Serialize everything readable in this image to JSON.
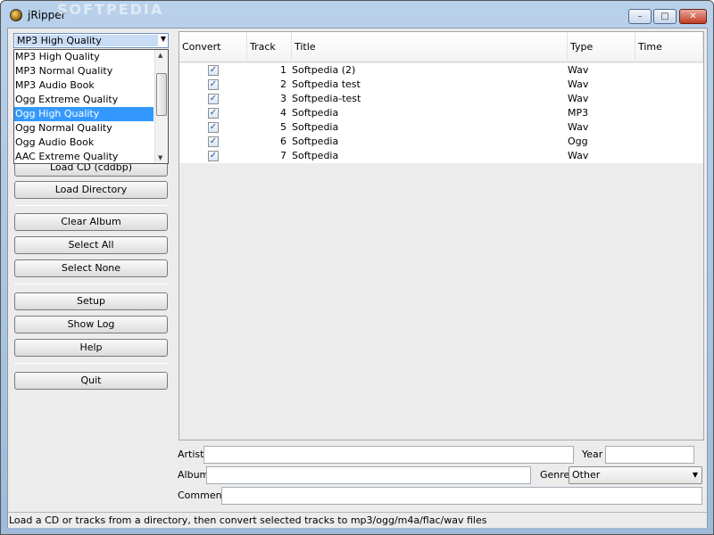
{
  "window": {
    "title": "jRipper",
    "watermark": "SOFTPEDIA"
  },
  "quality": {
    "selected": "MP3 High Quality",
    "options": [
      "MP3 High Quality",
      "MP3 Normal Quality",
      "MP3 Audio Book",
      "Ogg Extreme Quality",
      "Ogg High Quality",
      "Ogg Normal Quality",
      "Ogg Audio Book",
      "AAC Extreme Quality"
    ],
    "highlighted": "Ogg High Quality"
  },
  "buttons": {
    "load_cd": "Load CD (cddbp)",
    "load_directory": "Load Directory",
    "clear_album": "Clear Album",
    "select_all": "Select All",
    "select_none": "Select None",
    "setup": "Setup",
    "show_log": "Show Log",
    "help": "Help",
    "quit": "Quit"
  },
  "table": {
    "columns": [
      "Convert",
      "Track",
      "Title",
      "Type",
      "Time"
    ],
    "rows": [
      {
        "convert": true,
        "track": "1",
        "title": "Softpedia (2)",
        "type": "Wav",
        "time": ""
      },
      {
        "convert": true,
        "track": "2",
        "title": "Softpedia test",
        "type": "Wav",
        "time": ""
      },
      {
        "convert": true,
        "track": "3",
        "title": "Softpedia-test",
        "type": "Wav",
        "time": ""
      },
      {
        "convert": true,
        "track": "4",
        "title": "Softpedia",
        "type": "MP3",
        "time": ""
      },
      {
        "convert": true,
        "track": "5",
        "title": "Softpedia",
        "type": "Wav",
        "time": ""
      },
      {
        "convert": true,
        "track": "6",
        "title": "Softpedia",
        "type": "Ogg",
        "time": ""
      },
      {
        "convert": true,
        "track": "7",
        "title": "Softpedia",
        "type": "Wav",
        "time": ""
      }
    ]
  },
  "fields": {
    "artist_label": "Artist",
    "artist_value": "",
    "year_label": "Year",
    "year_value": "",
    "album_label": "Album",
    "album_value": "",
    "genre_label": "Genre",
    "genre_value": "Other",
    "comment_label": "Comment",
    "comment_value": ""
  },
  "status": "Load a CD or tracks from a directory, then convert selected tracks to mp3/ogg/m4a/flac/wav files",
  "icons": {
    "app": "jripper-icon",
    "check": "checkmark-icon"
  }
}
